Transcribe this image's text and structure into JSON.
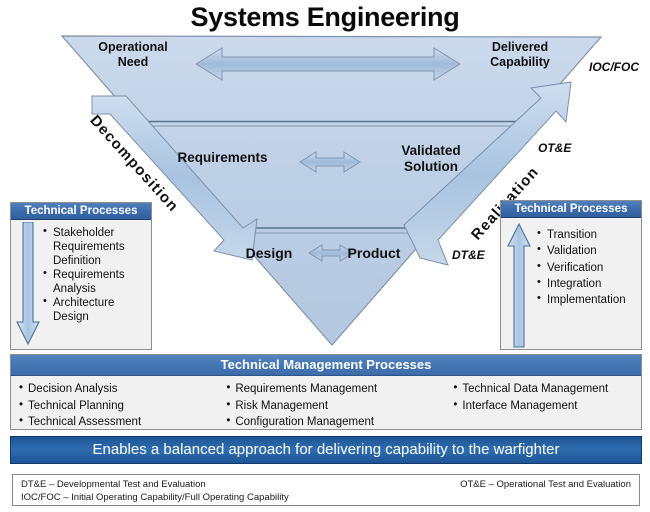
{
  "title": "Systems Engineering",
  "diagram": {
    "top_left_label": "Operational\nNeed",
    "top_left_line1": "Operational",
    "top_left_line2": "Need",
    "top_right_line1": "Delivered",
    "top_right_line2": "Capability",
    "mid_left_label": "Requirements",
    "mid_right_line1": "Validated",
    "mid_right_line2": "Solution",
    "bottom_left_label": "Design",
    "bottom_right_label": "Product",
    "left_arrow_label": "Decomposition",
    "right_arrow_label": "Realization",
    "side_labels": {
      "ioc_foc": "IOC/FOC",
      "ot_e": "OT&E",
      "dt_e": "DT&E"
    }
  },
  "technical_processes_left": {
    "header": "Technical Processes",
    "items": [
      "Stakeholder Requirements Definition",
      "Requirements Analysis",
      "Architecture Design"
    ]
  },
  "technical_processes_right": {
    "header": "Technical Processes",
    "items": [
      "Transition",
      "Validation",
      "Verification",
      "Integration",
      "Implementation"
    ]
  },
  "technical_management": {
    "header": "Technical Management Processes",
    "column1": [
      "Decision Analysis",
      "Technical Planning",
      "Technical Assessment"
    ],
    "column2": [
      "Requirements Management",
      "Risk Management",
      "Configuration Management"
    ],
    "column3": [
      "Technical Data Management",
      "Interface Management"
    ]
  },
  "banner": "Enables a balanced approach for delivering capability to the warfighter",
  "legend": {
    "dt_e": "DT&E – Developmental Test and Evaluation",
    "ot_e": "OT&E – Operational Test and Evaluation",
    "ioc_foc": "IOC/FOC – Initial Operating Capability/Full Operating Capability"
  },
  "colors": {
    "triangle_fill": "#c3d4e8",
    "header_blue": "#3c6eb4",
    "banner_blue": "#1f5596",
    "arrow_blue": "#a9c4e0"
  }
}
